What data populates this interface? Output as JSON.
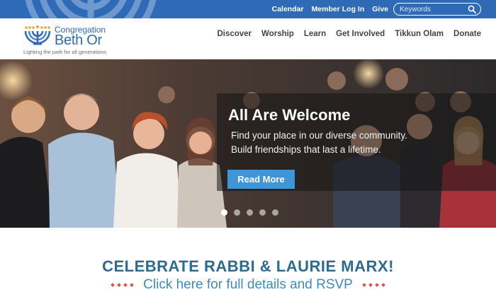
{
  "topbar": {
    "links": [
      "Calendar",
      "Member Log In",
      "Give"
    ],
    "search": {
      "placeholder": "Keywords",
      "value": ""
    }
  },
  "logo": {
    "line1": "Congregation",
    "line2": "Beth Or",
    "tagline": "Lighting the path for all generations"
  },
  "nav": {
    "items": [
      "Discover",
      "Worship",
      "Learn",
      "Get Involved",
      "Tikkun Olam",
      "Donate"
    ]
  },
  "hero": {
    "title": "All Are Welcome",
    "line1": "Find your place in our diverse community.",
    "line2": "Build friendships that last a lifetime.",
    "button": "Read More",
    "slide_count": 5,
    "active_slide": 1
  },
  "promo": {
    "title": "CELEBRATE RABBI & LAURIE MARX!",
    "link": "Click here for full details and RSVP"
  },
  "colors": {
    "brand_blue": "#2f6ab6",
    "button_blue": "#3f95d6",
    "promo_title": "#2f6a8f",
    "promo_link": "#3f8ac3",
    "accent_red": "#d9534f"
  },
  "icons": [
    "search-icon",
    "menorah-logo-icon",
    "menorah-watermark"
  ]
}
